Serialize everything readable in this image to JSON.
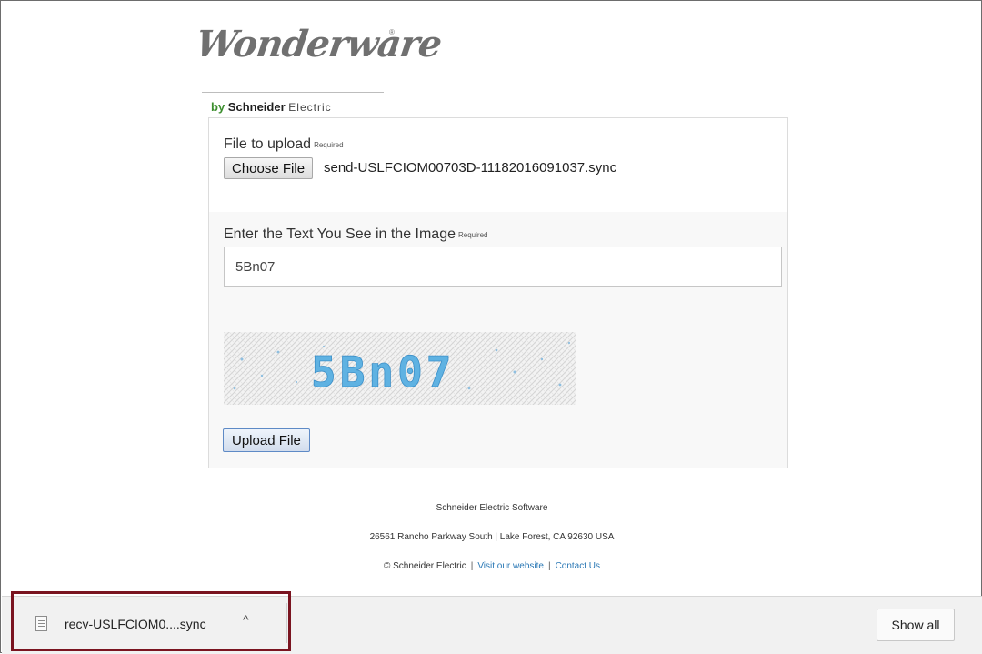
{
  "logo": {
    "wordmark": "Wonderware",
    "registered": "®",
    "by": "by",
    "brand": "Schneider",
    "electric": "Electric"
  },
  "form": {
    "file_label": "File to upload",
    "required": "Required",
    "choose_button": "Choose File",
    "file_name": "send-USLFCIOM00703D-11182016091037.sync",
    "captcha_label": "Enter the Text You See in the Image",
    "captcha_value": "5Bn07",
    "captcha_image_text": "5Bn07",
    "upload_button": "Upload File"
  },
  "footer": {
    "company": "Schneider Electric Software",
    "address": "26561 Rancho Parkway South | Lake Forest, CA 92630 USA",
    "copyright": "© Schneider Electric",
    "separator": "|",
    "visit_link": "Visit our website",
    "contact_link": "Contact Us",
    "link_color": "#2a78b5"
  },
  "download_bar": {
    "file_name": "recv-USLFCIOM0....sync",
    "chevron": "^",
    "show_all": "Show all",
    "highlight_color": "#7a1420"
  }
}
